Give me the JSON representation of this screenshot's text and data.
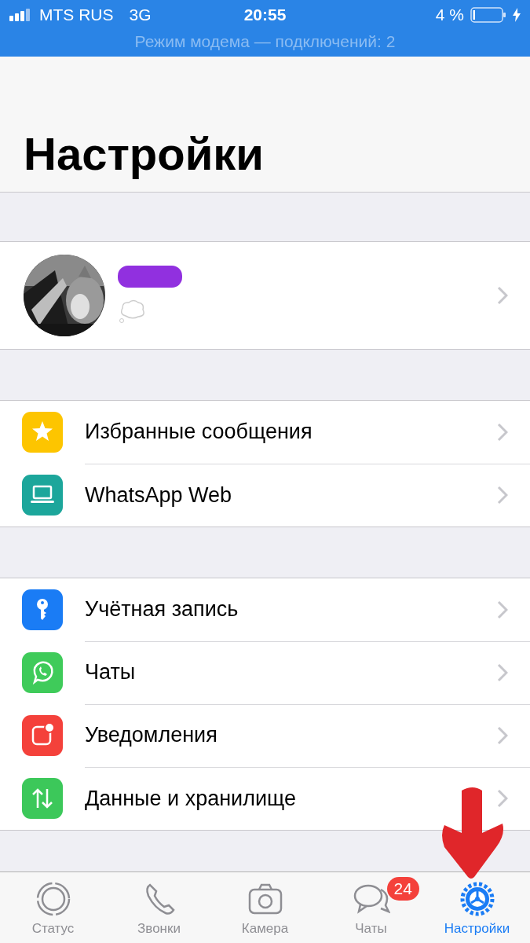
{
  "status_bar": {
    "carrier": "MTS RUS",
    "network": "3G",
    "time": "20:55",
    "battery": "4 %",
    "banner": "Режим модема — подключений: 2"
  },
  "title": "Настройки",
  "profile": {
    "avatar": {
      "kind": "picture"
    }
  },
  "groups": [
    [
      {
        "kind": "star",
        "label": "Избранные сообщения"
      },
      {
        "kind": "laptop",
        "label": "WhatsApp Web"
      }
    ],
    [
      {
        "kind": "key",
        "label": "Учётная запись"
      },
      {
        "kind": "chat",
        "label": "Чаты"
      },
      {
        "kind": "notify",
        "label": "Уведомления"
      },
      {
        "kind": "data",
        "label": "Данные и хранилище"
      }
    ]
  ],
  "tabs": [
    {
      "kind": "status",
      "label": "Статус",
      "selected": false
    },
    {
      "kind": "phone",
      "label": "Звонки",
      "selected": false
    },
    {
      "kind": "camera",
      "label": "Камера",
      "selected": false
    },
    {
      "kind": "chats",
      "label": "Чаты",
      "badge": "24",
      "selected": false
    },
    {
      "kind": "gear",
      "label": "Настройки",
      "selected": true
    }
  ]
}
